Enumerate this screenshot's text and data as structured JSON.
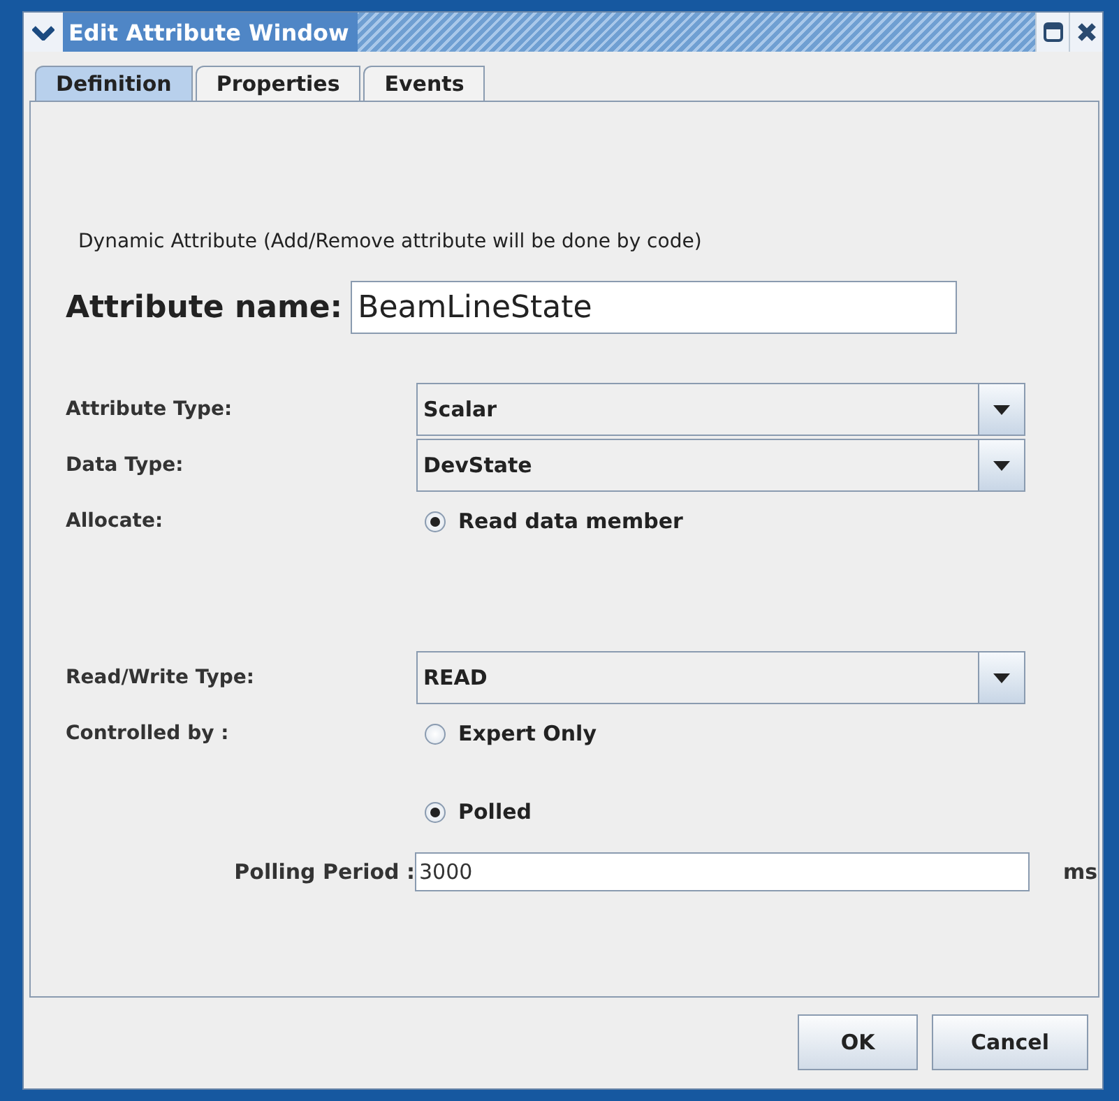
{
  "window": {
    "title": "Edit Attribute Window"
  },
  "tabs": [
    {
      "label": "Definition",
      "selected": true
    },
    {
      "label": "Properties",
      "selected": false
    },
    {
      "label": "Events",
      "selected": false
    }
  ],
  "description": "Dynamic Attribute (Add/Remove attribute will be done by code)",
  "attribute_name": {
    "label": "Attribute name:",
    "value": "BeamLineState"
  },
  "attribute_type": {
    "label": "Attribute Type:",
    "value": "Scalar"
  },
  "data_type": {
    "label": "Data Type:",
    "value": "DevState"
  },
  "allocate": {
    "label": "Allocate:",
    "option": "Read data member",
    "checked": true
  },
  "read_write_type": {
    "label": "Read/Write Type:",
    "value": "READ"
  },
  "controlled_by": {
    "label": "Controlled by :",
    "option": "Expert Only",
    "checked": false
  },
  "polled": {
    "option": "Polled",
    "checked": true
  },
  "polling_period": {
    "label": "Polling Period :",
    "value": "3000",
    "unit": "ms"
  },
  "buttons": [
    "OK",
    "Cancel"
  ]
}
